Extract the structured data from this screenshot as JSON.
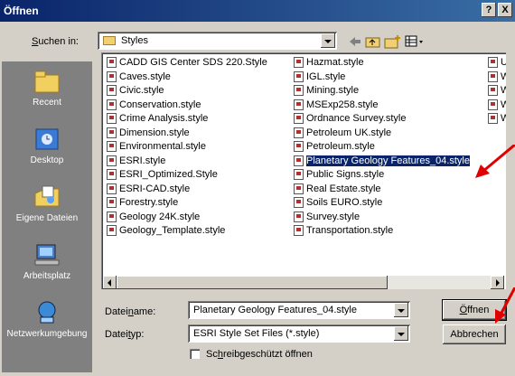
{
  "dialog": {
    "title": "Öffnen",
    "help_btn": "?",
    "close_btn": "X"
  },
  "lookin": {
    "label": "Suchen in:",
    "value": "Styles"
  },
  "places": [
    {
      "label": "Recent"
    },
    {
      "label": "Desktop"
    },
    {
      "label": "Eigene Dateien"
    },
    {
      "label": "Arbeitsplatz"
    },
    {
      "label": "Netzwerkumgebung"
    }
  ],
  "files": {
    "col1": [
      "CADD GIS Center SDS 220.Style",
      "Caves.style",
      "Civic.style",
      "Conservation.style",
      "Crime Analysis.style",
      "Dimension.style",
      "Environmental.style",
      "ESRI.style",
      "ESRI_Optimized.Style",
      "ESRI-CAD.style",
      "Forestry.style",
      "Geology 24K.style",
      "Geology_Template.style"
    ],
    "col2": [
      "Hazmat.style",
      "IGL.style",
      "Mining.style",
      "MSExp258.style",
      "Ordnance Survey.style",
      "Petroleum UK.style",
      "Petroleum.style",
      "Planetary Geology Features_04.style",
      "Public Signs.style",
      "Real Estate.style",
      "Soils EURO.style",
      "Survey.style",
      "Transportation.style"
    ],
    "col3": [
      "Util",
      "Wa",
      "We",
      "We",
      "Win"
    ],
    "selected": "Planetary Geology Features_04.style"
  },
  "filename": {
    "label": "Dateiname:",
    "value": "Planetary Geology Features_04.style"
  },
  "filetype": {
    "label": "Dateityp:",
    "value": "ESRI Style Set Files (*.style)"
  },
  "readonly": {
    "label": "Schreibgeschützt öffnen"
  },
  "buttons": {
    "open": "Öffnen",
    "cancel": "Abbrechen"
  },
  "colors": {
    "title_start": "#0a246a",
    "title_end": "#3a6ea5",
    "selection": "#0a246a",
    "annotation_arrow": "#e00000"
  }
}
